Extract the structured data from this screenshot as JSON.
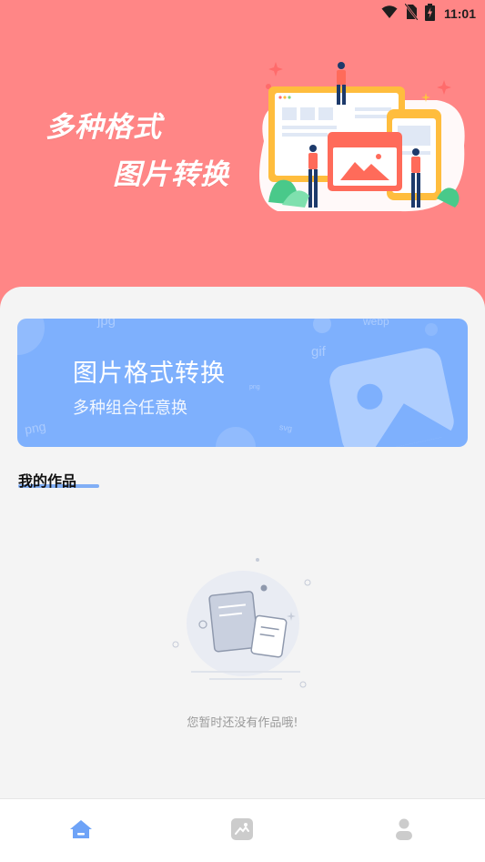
{
  "status_bar": {
    "time": "11:01",
    "icons": [
      "wifi-icon",
      "no-sim-icon",
      "battery-charging-icon"
    ]
  },
  "hero": {
    "line1": "多种格式",
    "line2": "图片转换",
    "background_color": "#ff8686"
  },
  "banner": {
    "title": "图片格式转换",
    "subtitle": "多种组合任意换",
    "background_color": "#7eb0fd",
    "decor_words": [
      "jpg",
      "webp",
      "gif",
      "png",
      "png",
      "svg"
    ]
  },
  "works": {
    "title": "我的作品",
    "empty_text": "您暂时还没有作品哦!",
    "accent_color": "#80aef5"
  },
  "bottom_nav": {
    "items": [
      {
        "icon": "home-icon",
        "active": true
      },
      {
        "icon": "image-icon",
        "active": false
      },
      {
        "icon": "user-icon",
        "active": false
      }
    ],
    "active_color": "#6ea3f7",
    "inactive_color": "#cccccc"
  }
}
